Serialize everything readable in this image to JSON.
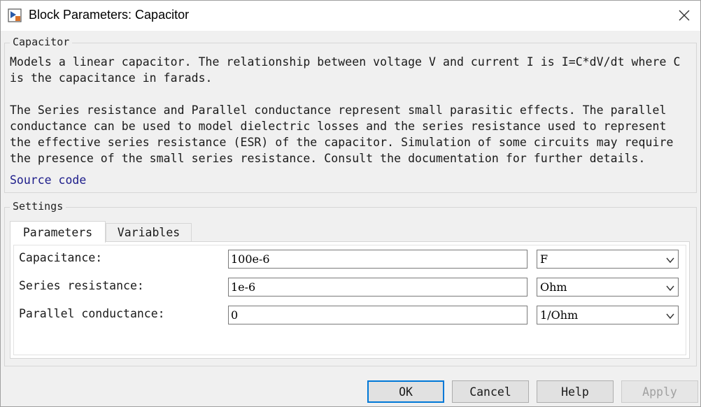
{
  "window": {
    "title": "Block Parameters: Capacitor",
    "icons": {
      "app": "simulink-block-icon",
      "close": "close-icon"
    }
  },
  "description": {
    "group_label": "Capacitor",
    "paragraph1_line1": "Models a linear capacitor. The relationship between voltage V and current I is I=C*dV/dt where C",
    "paragraph1_line2": "is the capacitance in farads.",
    "paragraph2_line1": "The Series resistance and Parallel conductance represent small parasitic effects. The parallel",
    "paragraph2_line2": "conductance can be used to model dielectric losses and the series resistance used to represent",
    "paragraph2_line3": "the effective series resistance (ESR) of the capacitor. Simulation of some circuits may require",
    "paragraph2_line4": "the presence of the small series resistance. Consult the documentation for further details.",
    "source_link": "Source code"
  },
  "settings": {
    "group_label": "Settings",
    "tabs": [
      {
        "label": "Parameters",
        "active": true
      },
      {
        "label": "Variables",
        "active": false
      }
    ],
    "params": [
      {
        "label": "Capacitance:",
        "value": "100e-6",
        "unit": "F"
      },
      {
        "label": "Series resistance:",
        "value": "1e-6",
        "unit": "Ohm"
      },
      {
        "label": "Parallel conductance:",
        "value": "0",
        "unit": "1/Ohm"
      }
    ]
  },
  "buttons": {
    "ok": "OK",
    "cancel": "Cancel",
    "help": "Help",
    "apply": "Apply"
  },
  "colors": {
    "link": "#1c1c8a",
    "focus_border": "#0078d7",
    "disabled_text": "#a0a0a0"
  }
}
